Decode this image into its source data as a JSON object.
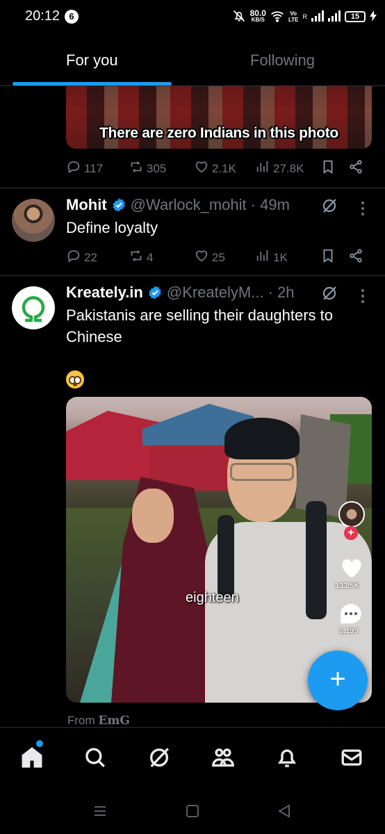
{
  "status_bar": {
    "time": "20:12",
    "notification_count": "6",
    "net_speed_value": "80.0",
    "net_speed_unit": "KB/S",
    "volte_label": "Vo\nLTE",
    "roaming": "R",
    "battery": "15"
  },
  "tabs": {
    "for_you": "For you",
    "following": "Following",
    "active": "for_you"
  },
  "posts": [
    {
      "media_caption": "There are zero Indians in this photo",
      "replies": "117",
      "reposts": "305",
      "likes": "2.1K",
      "views": "27.8K"
    },
    {
      "name": "Mohit",
      "handle": "@Warlock_mohit",
      "time": "· 49m",
      "text": "Define loyalty",
      "replies": "22",
      "reposts": "4",
      "likes": "25",
      "views": "1K"
    },
    {
      "name": "Kreately.in",
      "handle": "@KreatelyM...",
      "time": "· 2h",
      "text_line1": "Pakistanis are selling their daughters to",
      "text_line2": "Chinese",
      "emoji": "flushed-face",
      "media_caption": "eighteen",
      "overlay_likes": "133.5K",
      "overlay_comments": "2,199",
      "from_prefix": "From",
      "from_source": "EmG"
    }
  ],
  "bottom_nav": [
    "home",
    "search",
    "grok",
    "communities",
    "notifications",
    "messages"
  ],
  "colors": {
    "accent": "#1d9bf0",
    "background": "#000000",
    "secondary_text": "#71767b",
    "divider": "#2f3336"
  }
}
